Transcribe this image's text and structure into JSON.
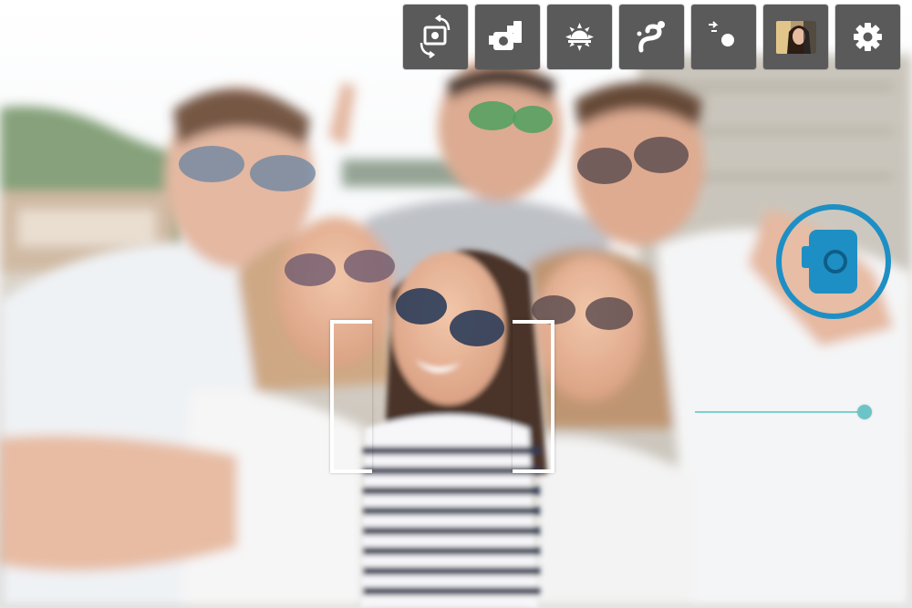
{
  "toolbar": {
    "buttons": [
      {
        "name": "switch-camera-button",
        "icon": "camera-rotate-icon"
      },
      {
        "name": "camera-mode-button",
        "icon": "video-camera-icon"
      },
      {
        "name": "exposure-button",
        "icon": "sun-icon"
      },
      {
        "name": "filter-effect-button",
        "icon": "magic-swirl-icon"
      },
      {
        "name": "focus-mode-button",
        "icon": "focus-dot-icon"
      },
      {
        "name": "gallery-thumbnail-button",
        "icon": "photo-thumbnail"
      },
      {
        "name": "settings-button",
        "icon": "gear-icon"
      }
    ]
  },
  "shutter": {
    "icon": "camera-icon",
    "accent_color": "#1e8fc4"
  },
  "zoom": {
    "level": 0.97,
    "track_color": "#7fcfd0"
  }
}
